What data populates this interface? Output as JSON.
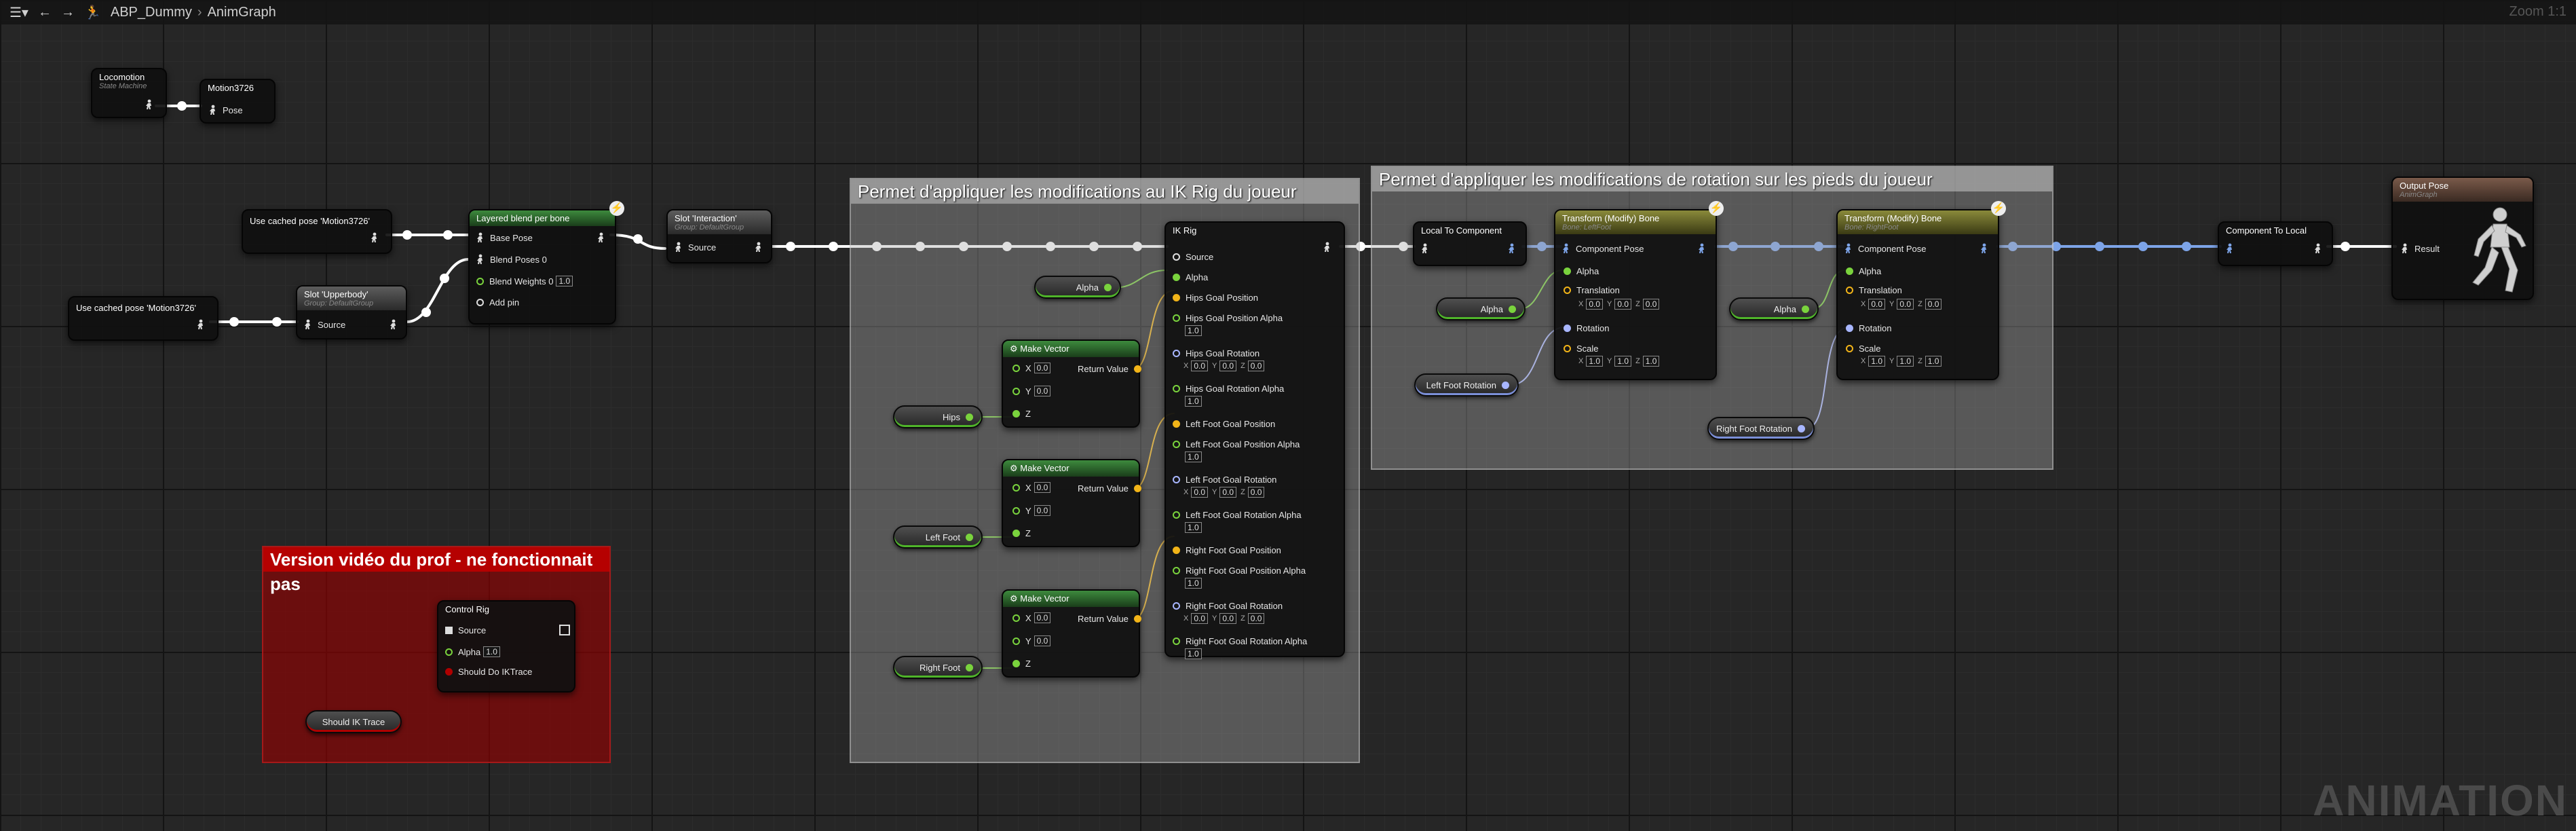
{
  "breadcrumb": {
    "asset": "ABP_Dummy",
    "graph": "AnimGraph"
  },
  "zoom_label": "Zoom 1:1",
  "watermark": "ANIMATION",
  "colors": {
    "exec_wire": "#ffffff",
    "pose_wire": "#ffffff",
    "transform_wire": "#7da4e8",
    "float_wire": "#7ad33d",
    "vector_wire": "#f2b418",
    "rotator_wire": "#a8b6ff",
    "comment_red": "#a00000"
  },
  "comments": {
    "ik_rig": "Permet d'appliquer les modifications au IK Rig du joueur",
    "feet_rotation": "Permet d'appliquer les modifications de rotation sur les pieds du joueur",
    "video_version": "Version vidéo du prof - ne fonctionnait pas"
  },
  "nodes": {
    "locomotion": {
      "title": "Locomotion",
      "subtitle": "State Machine"
    },
    "motion_save": {
      "title": "Motion3726",
      "pin": "Pose"
    },
    "cached_pose_1": {
      "title": "Use cached pose 'Motion3726'"
    },
    "cached_pose_2": {
      "title": "Use cached pose 'Motion3726'"
    },
    "slot_upperbody": {
      "title": "Slot 'Upperbody'",
      "subtitle": "Group: DefaultGroup",
      "pin": "Source"
    },
    "layered_blend": {
      "title": "Layered blend per bone",
      "base_pose": "Base Pose",
      "blend_poses": "Blend Poses 0",
      "blend_weights": "Blend Weights 0",
      "blend_weights_value": "1.0",
      "add_pin": "Add pin"
    },
    "slot_interaction": {
      "title": "Slot 'Interaction'",
      "subtitle": "Group: DefaultGroup",
      "pin": "Source"
    },
    "ik_rig": {
      "title": "IK Rig",
      "pins": [
        {
          "label": "Source",
          "kind": "pose"
        },
        {
          "label": "Alpha",
          "kind": "float"
        },
        {
          "label": "Hips Goal Position",
          "kind": "vector"
        },
        {
          "label": "Hips Goal Position Alpha",
          "kind": "float",
          "value": "1.0"
        },
        {
          "label": "Hips Goal Rotation",
          "kind": "rotator",
          "xyz": [
            "0.0",
            "0.0",
            "0.0"
          ]
        },
        {
          "label": "Hips Goal Rotation Alpha",
          "kind": "float",
          "value": "1.0"
        },
        {
          "label": "Left Foot Goal Position",
          "kind": "vector"
        },
        {
          "label": "Left Foot Goal Position Alpha",
          "kind": "float",
          "value": "1.0"
        },
        {
          "label": "Left Foot Goal Rotation",
          "kind": "rotator",
          "xyz": [
            "0.0",
            "0.0",
            "0.0"
          ]
        },
        {
          "label": "Left Foot Goal Rotation Alpha",
          "kind": "float",
          "value": "1.0"
        },
        {
          "label": "Right Foot Goal Position",
          "kind": "vector"
        },
        {
          "label": "Right Foot Goal Position Alpha",
          "kind": "float",
          "value": "1.0"
        },
        {
          "label": "Right Foot Goal Rotation",
          "kind": "rotator",
          "xyz": [
            "0.0",
            "0.0",
            "0.0"
          ]
        },
        {
          "label": "Right Foot Goal Rotation Alpha",
          "kind": "float",
          "value": "1.0"
        }
      ]
    },
    "make_vector": {
      "title": "Make Vector",
      "x": "X",
      "y": "Y",
      "z": "Z",
      "out": "Return Value",
      "x_val": "0.0",
      "y_val": "0.0"
    },
    "local_to_component": {
      "title": "Local To Component"
    },
    "transform_left": {
      "title": "Transform (Modify) Bone",
      "subtitle": "Bone: LeftFoot",
      "component_pose": "Component Pose",
      "alpha": "Alpha",
      "translation": "Translation",
      "translation_xyz": [
        "0.0",
        "0.0",
        "0.0"
      ],
      "rotation": "Rotation",
      "scale": "Scale",
      "scale_xyz": [
        "1.0",
        "1.0",
        "1.0"
      ]
    },
    "transform_right": {
      "title": "Transform (Modify) Bone",
      "subtitle": "Bone: RightFoot",
      "component_pose": "Component Pose",
      "alpha": "Alpha",
      "translation": "Translation",
      "translation_xyz": [
        "0.0",
        "0.0",
        "0.0"
      ],
      "rotation": "Rotation",
      "scale": "Scale",
      "scale_xyz": [
        "1.0",
        "1.0",
        "1.0"
      ]
    },
    "component_to_local": {
      "title": "Component To Local"
    },
    "output_pose": {
      "title": "Output Pose",
      "subtitle": "AnimGraph",
      "pin": "Result"
    },
    "control_rig": {
      "title": "Control Rig",
      "source": "Source",
      "alpha": "Alpha",
      "alpha_value": "1.0",
      "should_do_ik": "Should Do IKTrace"
    }
  },
  "variables": {
    "alpha": "Alpha",
    "hips": "Hips",
    "left_foot": "Left Foot",
    "right_foot": "Right Foot",
    "left_foot_rotation": "Left Foot Rotation",
    "right_foot_rotation": "Right Foot Rotation",
    "should_ik_trace": "Should IK Trace"
  }
}
